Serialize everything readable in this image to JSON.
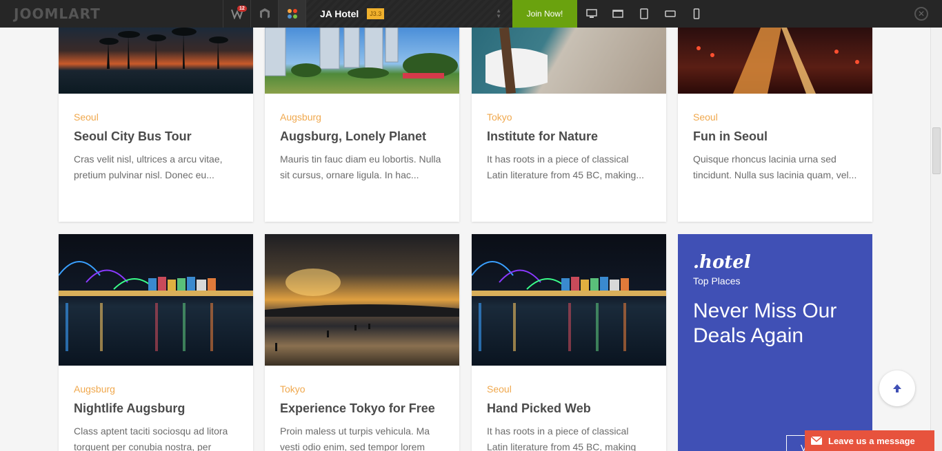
{
  "topbar": {
    "logo": "JoomlArt",
    "notification_count": "12",
    "theme_name": "JA Hotel",
    "theme_version": "J3.3",
    "join_label": "Join Now!"
  },
  "cards_top": [
    {
      "location": "Seoul",
      "title": "Seoul City Bus Tour",
      "description": "Cras velit nisl, ultrices a arcu vitae, pretium pulvinar nisl. Donec eu..."
    },
    {
      "location": "Augsburg",
      "title": "Augsburg, Lonely Planet",
      "description": "Mauris tin fauc diam eu lobortis. Nulla sit cursus, ornare ligula. In hac..."
    },
    {
      "location": "Tokyo",
      "title": "Institute for Nature",
      "description": "It has roots in a piece of classical Latin literature from 45 BC, making..."
    },
    {
      "location": "Seoul",
      "title": "Fun in Seoul",
      "description": "Quisque rhoncus lacinia urna sed tincidunt. Nulla sus lacinia quam, vel..."
    }
  ],
  "cards_bottom": [
    {
      "location": "Augsburg",
      "title": "Nightlife Augsburg",
      "description": "Class aptent taciti sociosqu ad litora torquent per conubia nostra, per"
    },
    {
      "location": "Tokyo",
      "title": "Experience Tokyo for Free",
      "description": "Proin maless ut turpis vehicula. Ma vesti odio enim, sed tempor lorem"
    },
    {
      "location": "Seoul",
      "title": "Hand Picked Web",
      "description": "It has roots in a piece of classical Latin literature from 45 BC, making"
    }
  ],
  "promo": {
    "brand": ".hotel",
    "subtitle": "Top Places",
    "headline": "Never Miss Our Deals Again",
    "button": "V"
  },
  "chat": {
    "label": "Leave us a message"
  },
  "colors": {
    "accent": "#4050b5",
    "location": "#f0a84d",
    "join": "#6aa20e",
    "chat": "#e7533d"
  }
}
